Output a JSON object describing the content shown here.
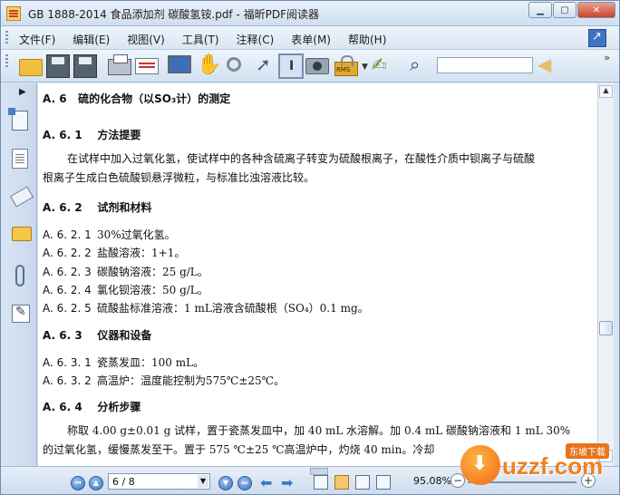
{
  "window": {
    "title": "GB 1888-2014 食品添加剂 碳酸氢铵.pdf - 福昕PDF阅读器",
    "minimize": "▁",
    "maximize": "▢",
    "close": "✕"
  },
  "menu": {
    "items": [
      "文件(F)",
      "编辑(E)",
      "视图(V)",
      "工具(T)",
      "注释(C)",
      "表单(M)",
      "帮助(H)"
    ]
  },
  "toolbar": {
    "search_placeholder": "",
    "rms_label": "RMS",
    "more": "»"
  },
  "document": {
    "section_title": {
      "num": "A. 6",
      "text": "硫的化合物（以SO₃计）的测定"
    },
    "s1": {
      "num": "A. 6. 1",
      "text": "方法提要"
    },
    "p1_line1": "在试样中加入过氧化氢，使试样中的各种含硫离子转变为硫酸根离子，在酸性介质中钡离子与硫酸",
    "p1_line2": "根离子生成白色硫酸钡悬浮微粒，与标准比浊溶液比较。",
    "s2": {
      "num": "A. 6. 2",
      "text": "试剂和材料"
    },
    "reagents": [
      {
        "num": "A. 6. 2. 1",
        "text": "30%过氧化氢。"
      },
      {
        "num": "A. 6. 2. 2",
        "text": "盐酸溶液：1+1。"
      },
      {
        "num": "A. 6. 2. 3",
        "text": "碳酸钠溶液：25 g/L。"
      },
      {
        "num": "A. 6. 2. 4",
        "text": "氯化钡溶液：50 g/L。"
      },
      {
        "num": "A. 6. 2. 5",
        "text": "硫酸盐标准溶液：1 mL溶液含硫酸根（SO₄）0.1 mg。"
      }
    ],
    "s3": {
      "num": "A. 6. 3",
      "text": "仪器和设备"
    },
    "instruments": [
      {
        "num": "A. 6. 3. 1",
        "text": "瓷蒸发皿：100 mL。"
      },
      {
        "num": "A. 6. 3. 2",
        "text": "高温炉：温度能控制为575℃±25℃。"
      }
    ],
    "s4": {
      "num": "A. 6. 4",
      "text": "分析步骤"
    },
    "p2_line1": "称取 4.00 g±0.01 g 试样，置于瓷蒸发皿中，加 40 mL 水溶解。加 0.4 mL 碳酸钠溶液和 1 mL 30%",
    "p2_line2": "的过氧化氢，缓慢蒸发至干。置于 575 ℃±25 ℃高温炉中，灼烧 40 min。冷却"
  },
  "statusbar": {
    "page": "6 / 8",
    "zoom": "95.08%"
  },
  "watermark": {
    "text": "uzzf.com",
    "tag": "东坡下载"
  }
}
